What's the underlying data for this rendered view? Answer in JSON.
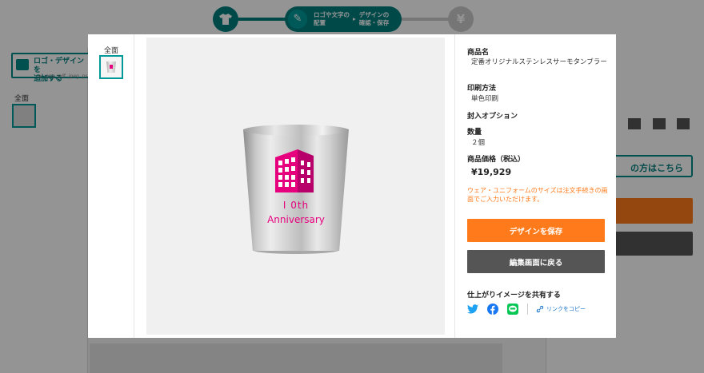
{
  "background": {
    "step_pill_line1": "ロゴや文字の",
    "step_pill_line2": "配置",
    "step_pill_next1": "デザインの",
    "step_pill_next2": "確認・保存",
    "yen_symbol": "¥",
    "upload_line1": "ロゴ・デザインを",
    "upload_line2": "追加する",
    "upload_sub": ".ai .png .pdf .jpeg .psd /",
    "view_all": "全面",
    "right_link_text": "の方はこちら",
    "accent_color": "#009999",
    "orange_color": "#ff7a1a"
  },
  "modal": {
    "views_label": "全面",
    "product_label": "商品名",
    "product_name": "定番オリジナルステンレスサーモタンブラー",
    "print_label": "印刷方法",
    "print_value": "単色印刷",
    "insert_label": "封入オプション",
    "qty_label": "数量",
    "qty_value": "２個",
    "price_label": "商品価格（税込）",
    "price_value": "¥19,929",
    "note": "ウェア・ユニフォームのサイズは注文手続きの画面でご入力いただけます。",
    "save_button": "デザインを保存",
    "back_button": "編集画面に戻る",
    "share_label": "仕上がりイメージを共有する",
    "copy_link": "リンクをコピー",
    "design_line1": "I 0th",
    "design_line2": "Anniversary",
    "design_color": "#e6007e",
    "icons": [
      "twitter-icon",
      "facebook-icon",
      "line-icon",
      "link-icon"
    ]
  }
}
